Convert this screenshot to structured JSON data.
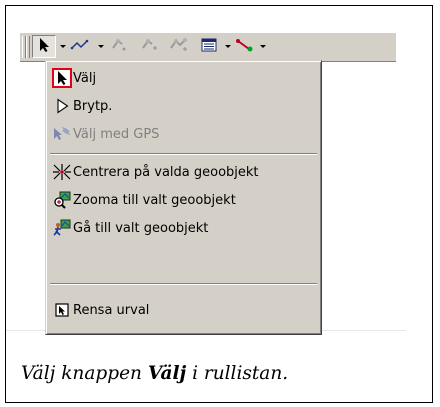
{
  "menu": {
    "items": [
      {
        "label": "Välj",
        "icon": "arrow-select-icon",
        "enabled": true,
        "selected": true
      },
      {
        "label": "Brytp.",
        "icon": "hollow-arrow-icon",
        "enabled": true,
        "selected": false
      },
      {
        "label": "Välj med GPS",
        "icon": "gps-satellite-icon",
        "enabled": false,
        "selected": false
      },
      {
        "label": "Centrera på valda geoobjekt",
        "icon": "center-target-icon",
        "enabled": true,
        "selected": false
      },
      {
        "label": "Zooma till valt geoobjekt",
        "icon": "zoom-to-feature-icon",
        "enabled": true,
        "selected": false
      },
      {
        "label": "Gå till valt geoobjekt",
        "icon": "go-to-feature-icon",
        "enabled": true,
        "selected": false
      },
      {
        "label": "Rensa urval",
        "icon": "clear-selection-icon",
        "enabled": true,
        "selected": false
      }
    ]
  },
  "toolbar": {
    "buttons": [
      {
        "icon": "select-arrow-icon",
        "pressed": true
      },
      {
        "icon": "polyline-icon",
        "pressed": false
      },
      {
        "icon": "add-vertex-icon",
        "pressed": false
      },
      {
        "icon": "add-point-icon",
        "pressed": false
      },
      {
        "icon": "add-node-icon",
        "pressed": false
      },
      {
        "icon": "attribute-table-icon",
        "pressed": false
      },
      {
        "icon": "snap-line-icon",
        "pressed": false
      }
    ]
  },
  "caption": {
    "prefix": "Välj knappen ",
    "bold": "Välj",
    "suffix": " i rullistan."
  },
  "colors": {
    "face": "#d4d0c8",
    "highlight_border": "#e0001a",
    "disabled_text": "#808080"
  }
}
